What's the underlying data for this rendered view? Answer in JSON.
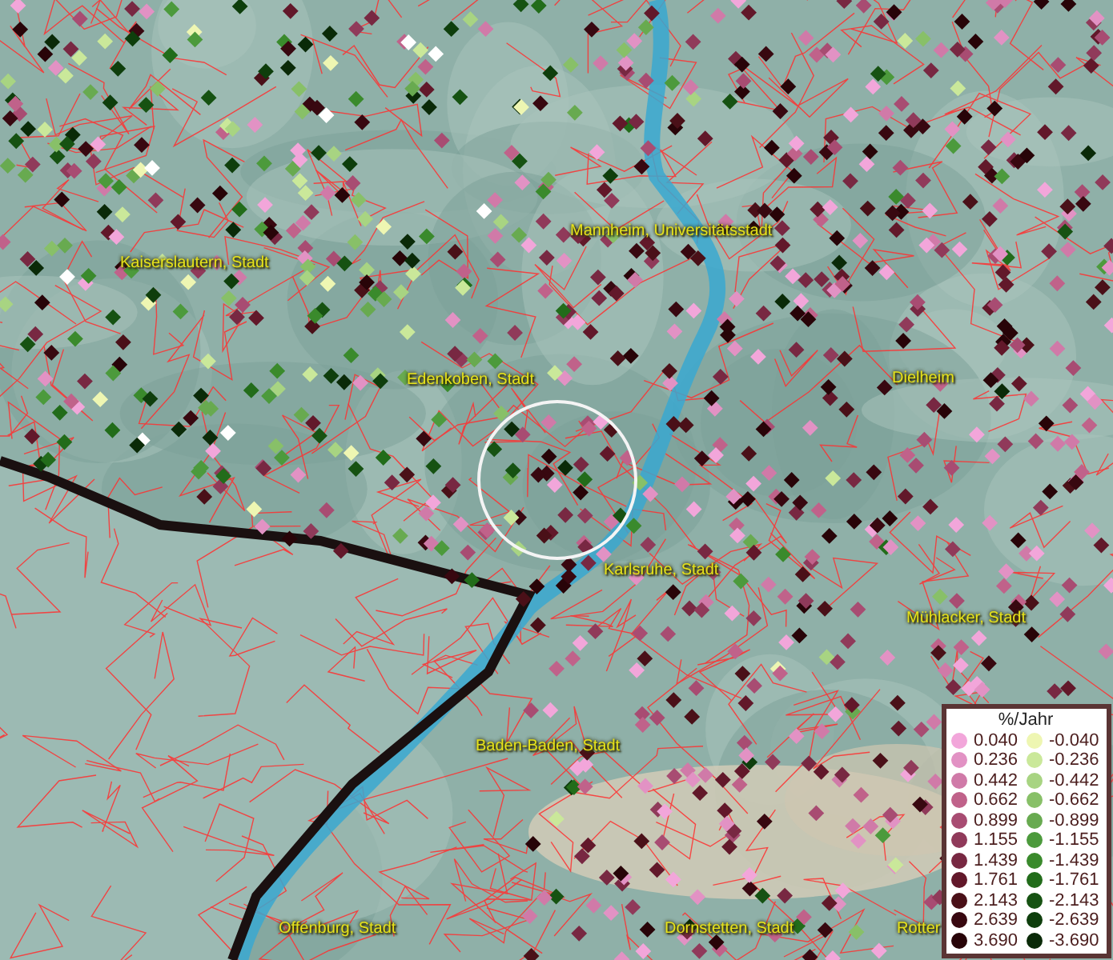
{
  "map": {
    "places": [
      {
        "name": "Kaiserslautern, Stadt"
      },
      {
        "name": "Mannheim, Universitätsstadt"
      },
      {
        "name": "Edenkoben, Stadt"
      },
      {
        "name": "Dielheim"
      },
      {
        "name": "Karlsruhe, Stadt"
      },
      {
        "name": "Mühlacker, Stadt"
      },
      {
        "name": "Baden-Baden, Stadt"
      },
      {
        "name": "Offenburg, Stadt"
      },
      {
        "name": "Dornstetten, Stadt"
      },
      {
        "name": "Rotter"
      }
    ]
  },
  "legend": {
    "title": "%/Jahr",
    "rows": [
      {
        "positive": {
          "label": "0.040",
          "color": "#f2a6da"
        },
        "negative": {
          "label": "-0.040",
          "color": "#eef6b2"
        }
      },
      {
        "positive": {
          "label": "0.236",
          "color": "#e292c4"
        },
        "negative": {
          "label": "-0.236",
          "color": "#cae89a"
        }
      },
      {
        "positive": {
          "label": "0.442",
          "color": "#d07aa8"
        },
        "negative": {
          "label": "-0.442",
          "color": "#a8d482"
        }
      },
      {
        "positive": {
          "label": "0.662",
          "color": "#c0628a"
        },
        "negative": {
          "label": "-0.662",
          "color": "#88c068"
        }
      },
      {
        "positive": {
          "label": "0.899",
          "color": "#a84c72"
        },
        "negative": {
          "label": "-0.899",
          "color": "#68aa50"
        }
      },
      {
        "positive": {
          "label": "1.155",
          "color": "#903a5a"
        },
        "negative": {
          "label": "-1.155",
          "color": "#4c9a3c"
        }
      },
      {
        "positive": {
          "label": "1.439",
          "color": "#782842"
        },
        "negative": {
          "label": "-1.439",
          "color": "#3a8a2c"
        }
      },
      {
        "positive": {
          "label": "1.761",
          "color": "#62182a"
        },
        "negative": {
          "label": "-1.761",
          "color": "#226c1a"
        }
      },
      {
        "positive": {
          "label": "2.143",
          "color": "#4a1018"
        },
        "negative": {
          "label": "-2.143",
          "color": "#165212"
        }
      },
      {
        "positive": {
          "label": "2.639",
          "color": "#380810"
        },
        "negative": {
          "label": "-2.639",
          "color": "#0e3e0c"
        }
      },
      {
        "positive": {
          "label": "3.690",
          "color": "#280408"
        },
        "negative": {
          "label": "-3.690",
          "color": "#0a2a08"
        }
      }
    ]
  }
}
